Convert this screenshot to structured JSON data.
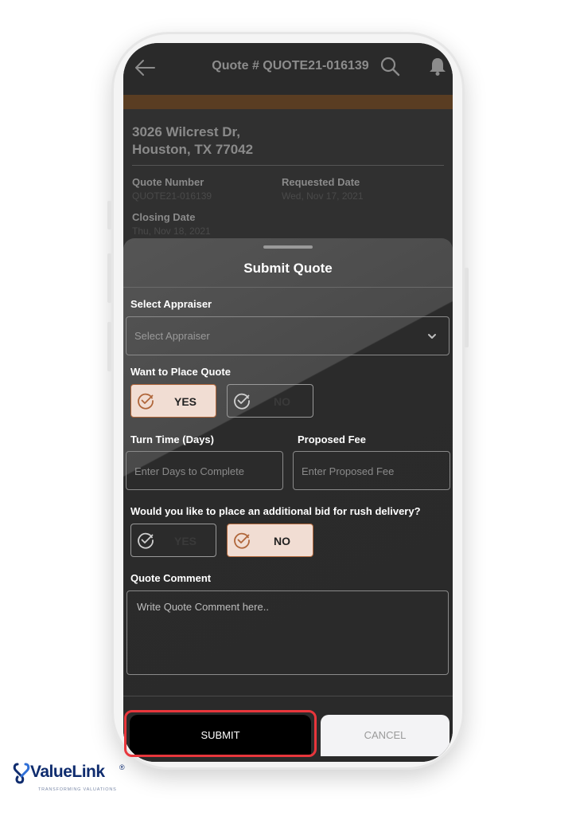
{
  "header": {
    "title": "Quote # QUOTE21-016139"
  },
  "property": {
    "address_line1": "3026 Wilcrest Dr,",
    "address_line2": "Houston, TX 77042",
    "quote_number_label": "Quote Number",
    "quote_number_value": "QUOTE21-016139",
    "requested_date_label": "Requested Date",
    "requested_date_value": "Wed, Nov 17, 2021",
    "closing_date_label": "Closing Date",
    "closing_date_value": "Thu, Nov 18, 2021"
  },
  "sheet": {
    "title": "Submit Quote",
    "appraiser": {
      "label": "Select Appraiser",
      "placeholder": "Select Appraiser"
    },
    "place_quote": {
      "label": "Want to Place Quote",
      "yes": "YES",
      "no": "NO",
      "selected": "YES"
    },
    "turn_time": {
      "label": "Turn Time (Days)",
      "placeholder": "Enter Days to Complete"
    },
    "proposed_fee": {
      "label": "Proposed Fee",
      "placeholder": "Enter Proposed Fee"
    },
    "rush": {
      "label": "Would you like to place an additional bid for rush delivery?",
      "yes": "YES",
      "no": "NO",
      "selected": "NO"
    },
    "comment": {
      "label": "Quote Comment",
      "placeholder": "Write Quote Comment here.."
    },
    "submit_label": "SUBMIT",
    "cancel_label": "CANCEL"
  },
  "brand": {
    "name": "ValueLink",
    "registered": "®",
    "tagline": "TRANSFORMING VALUATIONS"
  },
  "colors": {
    "accent": "#b0663a",
    "highlight": "#e8363c",
    "brand": "#0f2c6e"
  }
}
